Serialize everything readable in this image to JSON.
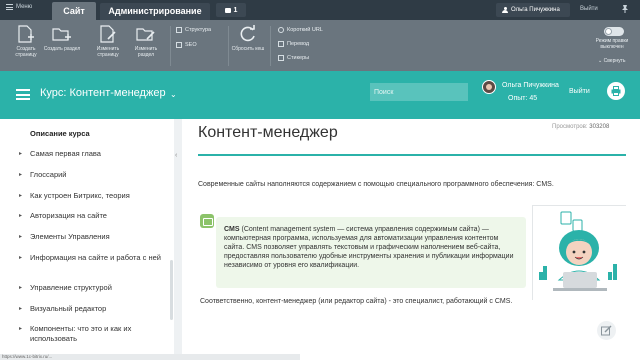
{
  "admin_top": {
    "menu_label": "Меню",
    "tab_site": "Сайт",
    "tab_admin": "Администрирование",
    "notifications_count": "1",
    "user_name": "Ольга Пичужкина",
    "logout_label": "Выйти"
  },
  "toolbar": {
    "create_page": "Создать страницу",
    "create_section": "Создать раздел",
    "edit_page": "Изменить страницу",
    "edit_section": "Изменить раздел",
    "structure": "Структура",
    "seo": "SEO",
    "reset_cache": "Сбросить кеш",
    "short_url": "Короткий URL",
    "translate": "Перевод",
    "stickers": "Стикеры",
    "mode_label": "Режим правки выключен",
    "collapse": "Свернуть"
  },
  "course_header": {
    "title": "Курс: Контент-менеджер",
    "search_placeholder": "Поиск",
    "user_name": "Ольга Пичужкина",
    "experience": "Опыт: 45",
    "logout_label": "Выйти"
  },
  "sidebar": {
    "items": [
      {
        "label": "Описание курса",
        "has_arrow": false
      },
      {
        "label": "Самая первая глава",
        "has_arrow": true
      },
      {
        "label": "Глоссарий",
        "has_arrow": true
      },
      {
        "label": "Как устроен Битрикс, теория",
        "has_arrow": true
      },
      {
        "label": "Авторизация на сайте",
        "has_arrow": true
      },
      {
        "label": "Элементы Управления",
        "has_arrow": true
      },
      {
        "label": "Информация на сайте и работа с ней",
        "has_arrow": true
      },
      {
        "label": "Управление структурой",
        "has_arrow": true
      },
      {
        "label": "Визуальный редактор",
        "has_arrow": true
      },
      {
        "label": "Компоненты: что это и как их использовать",
        "has_arrow": true
      }
    ]
  },
  "content": {
    "title": "Контент-менеджер",
    "views_label": "Просмотров:",
    "views_count": "303208",
    "intro": "Современные сайты наполняются содержанием с помощью специального программного обеспечения: CMS.",
    "note_term": "CMS",
    "note_body": " (Content management system — система управления содержимым сайта) — компьютерная программа, используемая для автоматизации управления контентом сайта. CMS позволяет управлять текстовым и графическим наполнением веб-сайта, предоставляя пользователю удобные инструменты хранения и публикации информации независимо от уровня его квалификации.",
    "paragraph2": "Соответственно, контент-менеджер (или редактор сайта) - это специалист, работающий с CMS."
  },
  "statusbar": {
    "url": "https://www.1c-bitrix.ru/..."
  },
  "colors": {
    "admin_dark": "#2f3b45",
    "toolbar_gray": "#6a757e",
    "brand_teal": "#2bb2a9",
    "note_green": "#eef7ea",
    "note_icon_green": "#8cc36a"
  }
}
